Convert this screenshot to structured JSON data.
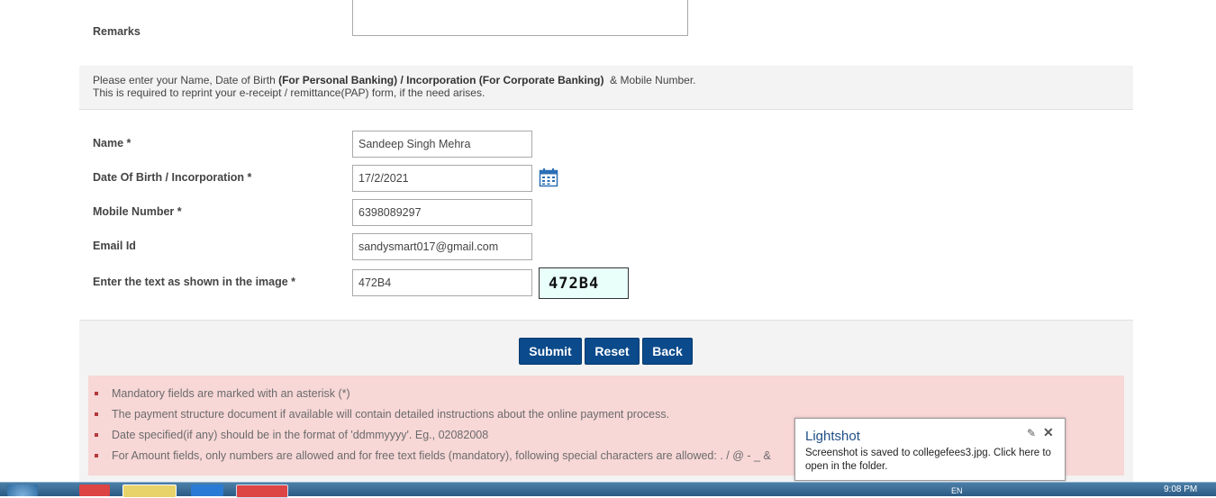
{
  "remarks": {
    "label": "Remarks"
  },
  "info": {
    "part1": "Please enter your Name, Date of Birth ",
    "bold1": "(For Personal Banking) / Incorporation (For Corporate Banking)",
    "part2": "  & Mobile Number.",
    "line2": "This is required to reprint your e-receipt / remittance(PAP) form, if the need arises."
  },
  "form": {
    "name_label": "Name *",
    "name_value": "Sandeep Singh Mehra",
    "dob_label": "Date Of Birth / Incorporation *",
    "dob_value": "17/2/2021",
    "mobile_label": "Mobile Number *",
    "mobile_value": "6398089297",
    "email_label": "Email Id",
    "email_value": "sandysmart017@gmail.com",
    "captcha_label": "Enter the text as shown in the image *",
    "captcha_value": "472B4",
    "captcha_image_text": "472B4"
  },
  "buttons": {
    "submit": "Submit",
    "reset": "Reset",
    "back": "Back"
  },
  "notes": [
    "Mandatory fields are marked with an asterisk (*)",
    "The payment structure document if available will contain detailed instructions about the online payment process.",
    "Date specified(if any) should be in the format of 'ddmmyyyy'. Eg., 02082008",
    "For Amount fields, only numbers are allowed and for free text fields (mandatory), following special characters are allowed: . / @ - _ &"
  ],
  "lightshot": {
    "title": "Lightshot",
    "message": "Screenshot is saved to collegefees3.jpg. Click here to open in the folder.",
    "pin_icon": "pin-icon",
    "close_icon": "close-icon"
  },
  "taskbar": {
    "language": "EN",
    "clock": "9:08 PM"
  },
  "colors": {
    "button": "#0b4a8b",
    "notes_bg": "#f8d7d7",
    "band_bg": "#f3f3f3",
    "captcha_bg": "#e8fffa"
  }
}
